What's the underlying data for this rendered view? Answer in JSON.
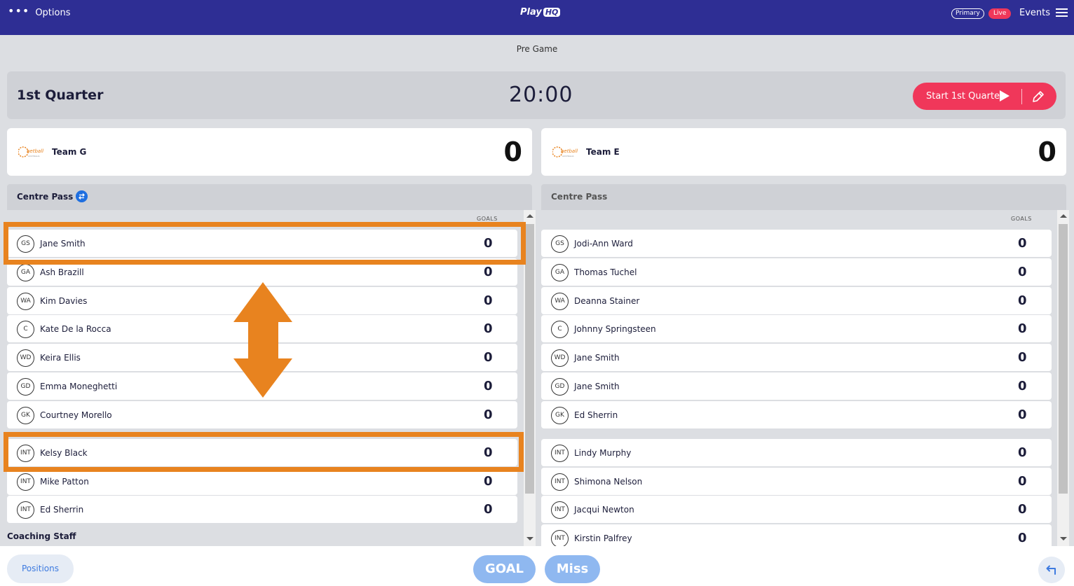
{
  "topbar": {
    "options_label": "Options",
    "logo_text": "Play",
    "logo_badge": "HQ",
    "primary_label": "Primary",
    "live_label": "Live",
    "events_label": "Events"
  },
  "pregame_label": "Pre Game",
  "quarter": {
    "label": "1st Quarter",
    "clock": "20:00",
    "start_label": "Start 1st Quarter"
  },
  "colors": {
    "brand": "#2e2e94",
    "live": "#f0375a",
    "highlight": "#e8831f",
    "action_blue": "#8fb8f0"
  },
  "teams": [
    {
      "name": "Team G",
      "score": "0",
      "centre_pass_label": "Centre Pass",
      "goals_header": "GOALS",
      "players": [
        {
          "pos": "GS",
          "name": "Jane Smith",
          "goals": "0"
        },
        {
          "pos": "GA",
          "name": "Ash Brazill",
          "goals": "0"
        },
        {
          "pos": "WA",
          "name": "Kim Davies",
          "goals": "0"
        },
        {
          "pos": "C",
          "name": "Kate De la Rocca",
          "goals": "0"
        },
        {
          "pos": "WD",
          "name": "Keira Ellis",
          "goals": "0"
        },
        {
          "pos": "GD",
          "name": "Emma Moneghetti",
          "goals": "0"
        },
        {
          "pos": "GK",
          "name": "Courtney Morello",
          "goals": "0"
        }
      ],
      "interchange": [
        {
          "pos": "INT",
          "name": "Kelsy Black",
          "goals": "0"
        },
        {
          "pos": "INT",
          "name": "Mike Patton",
          "goals": "0"
        },
        {
          "pos": "INT",
          "name": "Ed Sherrin",
          "goals": "0"
        }
      ],
      "coaching_staff_label": "Coaching Staff"
    },
    {
      "name": "Team E",
      "score": "0",
      "centre_pass_label": "Centre Pass",
      "goals_header": "GOALS",
      "players": [
        {
          "pos": "GS",
          "name": "Jodi-Ann Ward",
          "goals": "0"
        },
        {
          "pos": "GA",
          "name": "Thomas Tuchel",
          "goals": "0"
        },
        {
          "pos": "WA",
          "name": "Deanna Stainer",
          "goals": "0"
        },
        {
          "pos": "C",
          "name": "Johnny Springsteen",
          "goals": "0"
        },
        {
          "pos": "WD",
          "name": "Jane Smith",
          "goals": "0"
        },
        {
          "pos": "GD",
          "name": "Jane Smith",
          "goals": "0"
        },
        {
          "pos": "GK",
          "name": "Ed Sherrin",
          "goals": "0"
        }
      ],
      "interchange": [
        {
          "pos": "INT",
          "name": "Lindy Murphy",
          "goals": "0"
        },
        {
          "pos": "INT",
          "name": "Shimona Nelson",
          "goals": "0"
        },
        {
          "pos": "INT",
          "name": "Jacqui Newton",
          "goals": "0"
        },
        {
          "pos": "INT",
          "name": "Kirstin Palfrey",
          "goals": "0"
        }
      ]
    }
  ],
  "bottom": {
    "positions_label": "Positions",
    "goal_label": "GOAL",
    "miss_label": "Miss"
  }
}
